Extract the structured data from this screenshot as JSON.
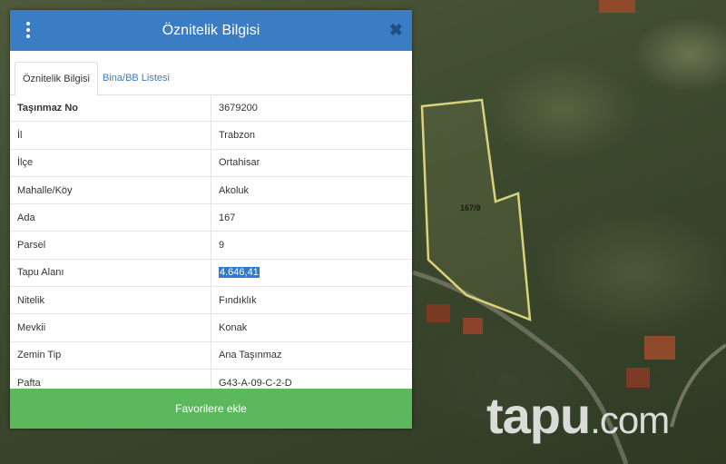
{
  "panel": {
    "title": "Öznitelik Bilgisi",
    "close_symbol": "✖",
    "menu_icon": "vertical-dots-icon",
    "accent_color": "#3a7dc4",
    "button_color": "#5cb85c"
  },
  "tabs": [
    {
      "label": "Öznitelik Bilgisi",
      "active": true
    },
    {
      "label": "Bina/BB Listesi",
      "active": false
    }
  ],
  "attributes": [
    {
      "key": "Taşınmaz No",
      "value": "3679200"
    },
    {
      "key": "İl",
      "value": "Trabzon"
    },
    {
      "key": "İlçe",
      "value": "Ortahisar"
    },
    {
      "key": "Mahalle/Köy",
      "value": "Akoluk"
    },
    {
      "key": "Ada",
      "value": "167"
    },
    {
      "key": "Parsel",
      "value": "9"
    },
    {
      "key": "Tapu Alanı",
      "value": "4.646,41"
    },
    {
      "key": "Nitelik",
      "value": "Fındıklık"
    },
    {
      "key": "Mevkii",
      "value": "Konak"
    },
    {
      "key": "Zemin Tip",
      "value": "Ana Taşınmaz"
    },
    {
      "key": "Pafta",
      "value": "G43-A-09-C-2-D"
    }
  ],
  "actions": {
    "favorite_label": "Favorilere ekle"
  },
  "map": {
    "parcel_label": "167/9",
    "watermark_main": "tapu",
    "watermark_suffix": ".com"
  }
}
